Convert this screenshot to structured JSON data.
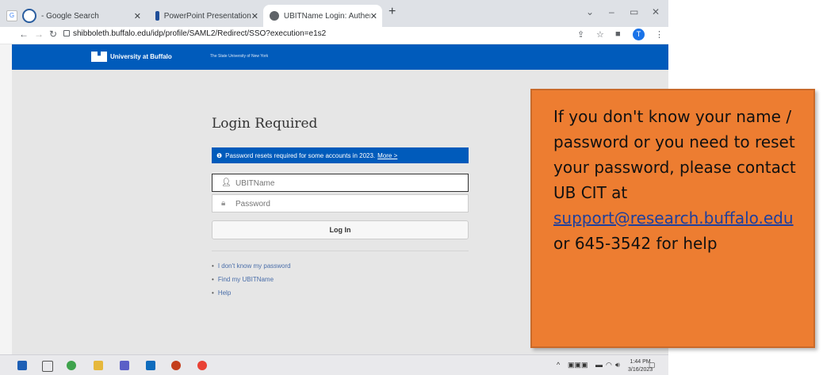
{
  "browser": {
    "tabs": [
      {
        "label": "- Google Search",
        "favicon": "google-icon"
      },
      {
        "label": "PowerPoint Presentation",
        "favicon": "powerpoint-icon"
      },
      {
        "label": "UBITName Login: Authentication",
        "favicon": "globe-icon"
      }
    ],
    "url": "shibboleth.buffalo.edu/idp/profile/SAML2/Redirect/SSO?execution=e1s2",
    "profile_initial": "T"
  },
  "site_header": {
    "name": "University at Buffalo",
    "subtitle": "The State University of New York"
  },
  "login": {
    "title": "Login Required",
    "alert_text": "Password resets required for some accounts in 2023.",
    "alert_link": "More >",
    "username_placeholder": "UBITName",
    "password_placeholder": "Password",
    "submit_label": "Log In",
    "links": [
      "I don't know my password",
      "Find my UBITName",
      "Help"
    ]
  },
  "callout": {
    "text_before": "If you don't know your name / password or you need to reset your password, please contact UB CIT at ",
    "email": "support@research.buffalo.edu",
    "text_after": " or 645-3542 for help"
  },
  "taskbar": {
    "time": "1:44 PM",
    "date": "3/16/2023"
  },
  "colors": {
    "ub_blue": "#005bbb",
    "callout_orange": "#ed7d31"
  }
}
